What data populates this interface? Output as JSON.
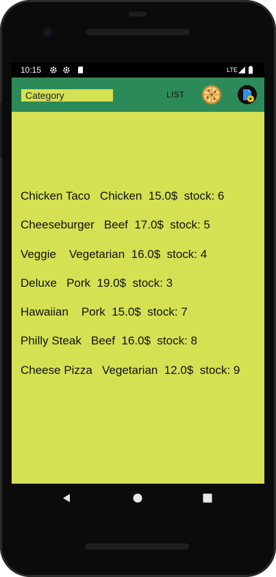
{
  "status_bar": {
    "time": "10:15",
    "network": "LTE"
  },
  "app_bar": {
    "category_placeholder": "Category",
    "list_label": "LIST"
  },
  "items": [
    {
      "text": "Chicken Taco   Chicken  15.0$  stock: 6"
    },
    {
      "text": "Cheeseburger   Beef  17.0$  stock: 5"
    },
    {
      "text": "Veggie    Vegetarian  16.0$  stock: 4"
    },
    {
      "text": "Deluxe   Pork  19.0$  stock: 3"
    },
    {
      "text": "Hawaiian    Pork  15.0$  stock: 7"
    },
    {
      "text": "Philly Steak   Beef  16.0$  stock: 8"
    },
    {
      "text": "Cheese Pizza   Vegetarian  12.0$  stock: 9"
    }
  ],
  "colors": {
    "app_bar": "#2c8a58",
    "background": "#d3e153"
  },
  "icons": [
    "settings-icon",
    "settings-icon",
    "sd-card-icon",
    "signal-icon",
    "battery-icon",
    "pizza-icon",
    "user-document-icon",
    "back-icon",
    "home-icon",
    "recents-icon"
  ]
}
